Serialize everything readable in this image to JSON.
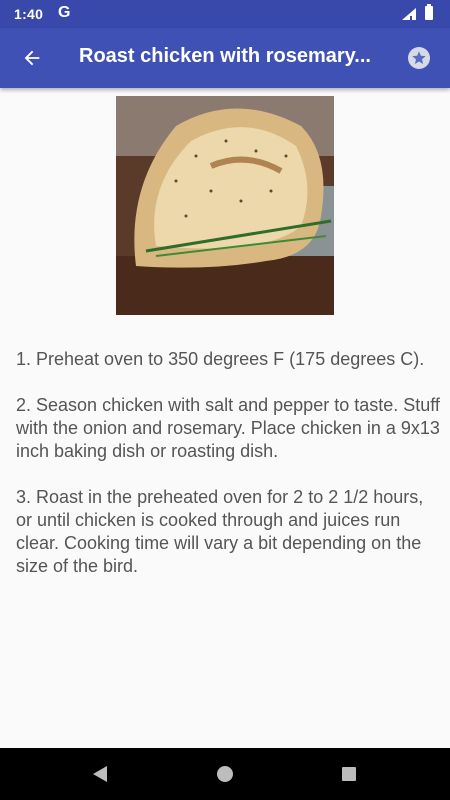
{
  "status_bar": {
    "time": "1:40",
    "g_label": "G",
    "accent_color": "#3949ab"
  },
  "app_bar": {
    "title": "Roast chicken with rosemary...",
    "back_icon": "arrow-back-icon",
    "favorite_icon": "star-icon",
    "color": "#3f51b5"
  },
  "recipe": {
    "image_icon": "roast-chicken-photo",
    "steps_text": "1. Preheat oven to 350 degrees F (175 degrees C).\n\n2. Season chicken with salt and pepper to taste. Stuff with the onion and rosemary. Place chicken in a 9x13 inch baking dish or roasting dish.\n\n3. Roast in the preheated oven for 2 to 2 1/2 hours, or until chicken is cooked through and juices run clear. Cooking time will vary a bit depending on the size of the bird."
  },
  "nav_bar": {
    "back_icon": "triangle-back-icon",
    "home_icon": "circle-home-icon",
    "recents_icon": "square-recents-icon"
  }
}
